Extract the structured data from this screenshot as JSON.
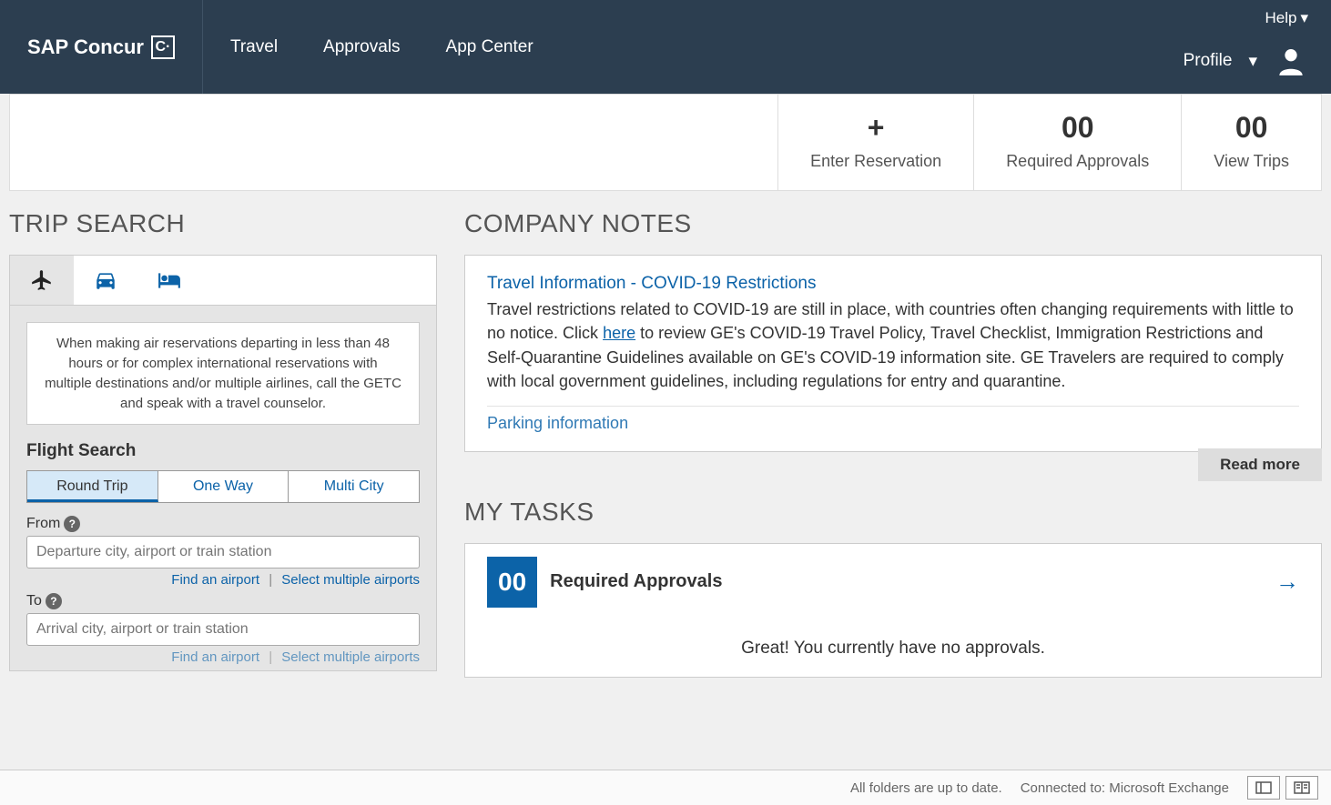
{
  "header": {
    "brand": "SAP Concur",
    "logo_letter": "C·",
    "nav": [
      "Travel",
      "Approvals",
      "App Center"
    ],
    "help": "Help",
    "profile": "Profile"
  },
  "quick_actions": {
    "enter_reservation": {
      "icon": "+",
      "label": "Enter Reservation"
    },
    "required_approvals": {
      "value": "00",
      "label": "Required Approvals"
    },
    "view_trips": {
      "value": "00",
      "label": "View Trips"
    }
  },
  "trip_search": {
    "title": "TRIP SEARCH",
    "info": "When making air reservations departing in less than 48 hours or for complex international reservations with multiple destinations and/or multiple airlines, call the GETC and speak with a travel counselor.",
    "flight_search_label": "Flight Search",
    "types": [
      "Round Trip",
      "One Way",
      "Multi City"
    ],
    "from_label": "From",
    "from_placeholder": "Departure city, airport or train station",
    "to_label": "To",
    "to_placeholder": "Arrival city, airport or train station",
    "find_airport": "Find an airport",
    "select_multiple": "Select multiple airports"
  },
  "company_notes": {
    "title": "COMPANY NOTES",
    "note_title": "Travel Information - COVID-19 Restrictions",
    "note_body_1": "Travel restrictions related to COVID-19 are still in place, with countries often changing requirements with little to no notice.  Click ",
    "note_link": "here",
    "note_body_2": " to review GE's COVID-19 Travel Policy, Travel Checklist, Immigration Restrictions and Self-Quarantine Guidelines available on GE's COVID-19 information site.  GE Travelers are required to comply with local government guidelines, including regulations for entry and quarantine.",
    "peek": "Parking information",
    "read_more": "Read more"
  },
  "my_tasks": {
    "title": "MY TASKS",
    "badge": "00",
    "task_title": "Required Approvals",
    "body": "Great! You currently have no approvals."
  },
  "status_bar": {
    "folders": "All folders are up to date.",
    "connection": "Connected to: Microsoft Exchange"
  }
}
